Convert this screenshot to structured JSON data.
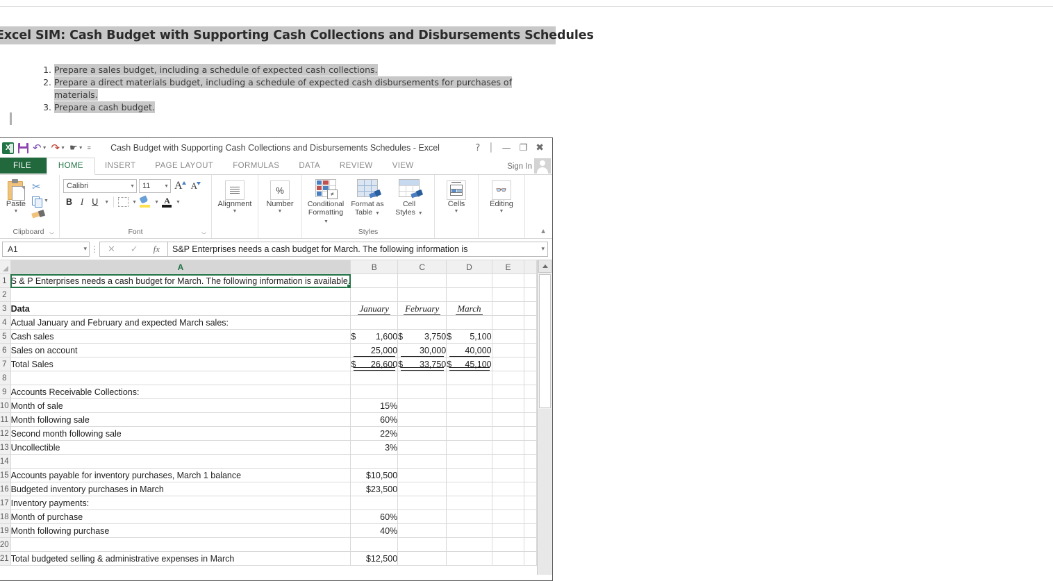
{
  "page": {
    "header_title": "Excel SIM: Cash Budget with Supporting Cash Collections and Disbursements Schedules",
    "instructions": [
      "Prepare a sales budget, including a schedule of expected cash collections.",
      "Prepare a direct materials budget, including a schedule of expected cash disbursements for purchases of materials.",
      "Prepare a cash budget."
    ]
  },
  "excel": {
    "window_title": "Cash Budget with Supporting Cash Collections and Disbursements Schedules - Excel",
    "quick_access": [
      {
        "name": "excel-logo",
        "label": "X"
      },
      {
        "name": "save-icon",
        "label": "Save"
      },
      {
        "name": "undo-icon",
        "label": "Undo"
      },
      {
        "name": "redo-icon",
        "label": "Redo"
      },
      {
        "name": "touch-mode-icon",
        "label": "Touch/Mouse Mode"
      },
      {
        "name": "customize-qat-icon",
        "label": "Customize Quick Access Toolbar"
      }
    ],
    "window_controls": {
      "help": "?",
      "ribbon_options": "Ribbon Display Options",
      "minimize": "Minimize",
      "restore": "Restore Down",
      "close": "Close"
    },
    "signin_label": "Sign In",
    "tabs": [
      {
        "label": "FILE",
        "active": false,
        "file": true
      },
      {
        "label": "HOME",
        "active": true,
        "file": false
      },
      {
        "label": "INSERT",
        "active": false,
        "file": false
      },
      {
        "label": "PAGE LAYOUT",
        "active": false,
        "file": false
      },
      {
        "label": "FORMULAS",
        "active": false,
        "file": false
      },
      {
        "label": "DATA",
        "active": false,
        "file": false
      },
      {
        "label": "REVIEW",
        "active": false,
        "file": false
      },
      {
        "label": "VIEW",
        "active": false,
        "file": false
      }
    ],
    "ribbon": {
      "clipboard": {
        "group_label": "Clipboard",
        "paste_label": "Paste",
        "cut_label": "Cut",
        "copy_label": "Copy",
        "format_painter_label": "Format Painter"
      },
      "font": {
        "group_label": "Font",
        "font_name": "Calibri",
        "font_size": "11",
        "bold": "B",
        "italic": "I",
        "underline": "U",
        "grow_font": "A",
        "shrink_font": "A",
        "borders_label": "Borders",
        "fill_color_label": "Fill Color",
        "font_color_label": "Font Color",
        "font_color_glyph": "A"
      },
      "alignment": {
        "group_label": "Alignment",
        "button_label": "Alignment"
      },
      "number": {
        "group_label": "Number",
        "button_label": "Number",
        "glyph": "%"
      },
      "styles": {
        "group_label": "Styles",
        "conditional_formatting": "Conditional\nFormatting",
        "conditional_formatting_l1": "Conditional",
        "conditional_formatting_l2": "Formatting",
        "format_as_table_l1": "Format as",
        "format_as_table_l2": "Table",
        "cell_styles_l1": "Cell",
        "cell_styles_l2": "Styles",
        "neq_glyph": "≠"
      },
      "cells": {
        "group_label": "",
        "button_label": "Cells"
      },
      "editing": {
        "group_label": "",
        "button_label": "Editing"
      },
      "collapse_label": "Collapse the Ribbon"
    },
    "formula_bar": {
      "name_box": "A1",
      "cancel": "✕",
      "enter": "✓",
      "insert_function": "fx",
      "value": "S&P Enterprises needs a cash budget for March. The following information is"
    },
    "sheet": {
      "columns": [
        "A",
        "B",
        "C",
        "D",
        "E"
      ],
      "active_cell": "A1",
      "rows": [
        {
          "n": "1",
          "a": "S & P Enterprises needs a cash budget for March. The following information is available.",
          "b": "",
          "c": "",
          "d": ""
        },
        {
          "n": "2",
          "a": "",
          "b": "",
          "c": "",
          "d": ""
        },
        {
          "n": "3",
          "a": "Data",
          "b": "January",
          "c": "February",
          "d": "March"
        },
        {
          "n": "4",
          "a": "Actual January and February and expected March sales:",
          "b": "",
          "c": "",
          "d": ""
        },
        {
          "n": "5",
          "a": "Cash sales",
          "b_sym": "$",
          "b": "1,600",
          "c_sym": "$",
          "c": "3,750",
          "d_sym": "$",
          "d": "5,100"
        },
        {
          "n": "6",
          "a": "Sales on account",
          "b": "25,000",
          "c": "30,000",
          "d": "40,000"
        },
        {
          "n": "7",
          "a": "Total Sales",
          "b_sym": "$",
          "b": "26,600",
          "c_sym": "$",
          "c": "33,750",
          "d_sym": "$",
          "d": "45,100"
        },
        {
          "n": "8",
          "a": "",
          "b": "",
          "c": "",
          "d": ""
        },
        {
          "n": "9",
          "a": "Accounts Receivable Collections:",
          "b": "",
          "c": "",
          "d": ""
        },
        {
          "n": "10",
          "a": "Month of sale",
          "b": "15%",
          "c": "",
          "d": ""
        },
        {
          "n": "11",
          "a": "Month following sale",
          "b": "60%",
          "c": "",
          "d": ""
        },
        {
          "n": "12",
          "a": "Second month following sale",
          "b": "22%",
          "c": "",
          "d": ""
        },
        {
          "n": "13",
          "a": "Uncollectible",
          "b": "3%",
          "c": "",
          "d": ""
        },
        {
          "n": "14",
          "a": "",
          "b": "",
          "c": "",
          "d": ""
        },
        {
          "n": "15",
          "a": "Accounts payable for inventory purchases, March 1 balance",
          "b": "$10,500",
          "c": "",
          "d": ""
        },
        {
          "n": "16",
          "a": "Budgeted inventory purchases in March",
          "b": "$23,500",
          "c": "",
          "d": ""
        },
        {
          "n": "17",
          "a": "Inventory payments:",
          "b": "",
          "c": "",
          "d": ""
        },
        {
          "n": "18",
          "a": "Month of purchase",
          "b": "60%",
          "c": "",
          "d": ""
        },
        {
          "n": "19",
          "a": "Month following purchase",
          "b": "40%",
          "c": "",
          "d": ""
        },
        {
          "n": "20",
          "a": "",
          "b": "",
          "c": "",
          "d": ""
        },
        {
          "n": "21",
          "a": "Total budgeted selling & administrative expenses in March",
          "b": "$12,500",
          "c": "",
          "d": ""
        }
      ]
    }
  },
  "colors": {
    "excel_green": "#217346",
    "file_tab_green": "#21683c",
    "highlight_gray": "#c8c8c8",
    "grid_line": "#d9d9d9",
    "header_gray": "#f0f0f0"
  }
}
